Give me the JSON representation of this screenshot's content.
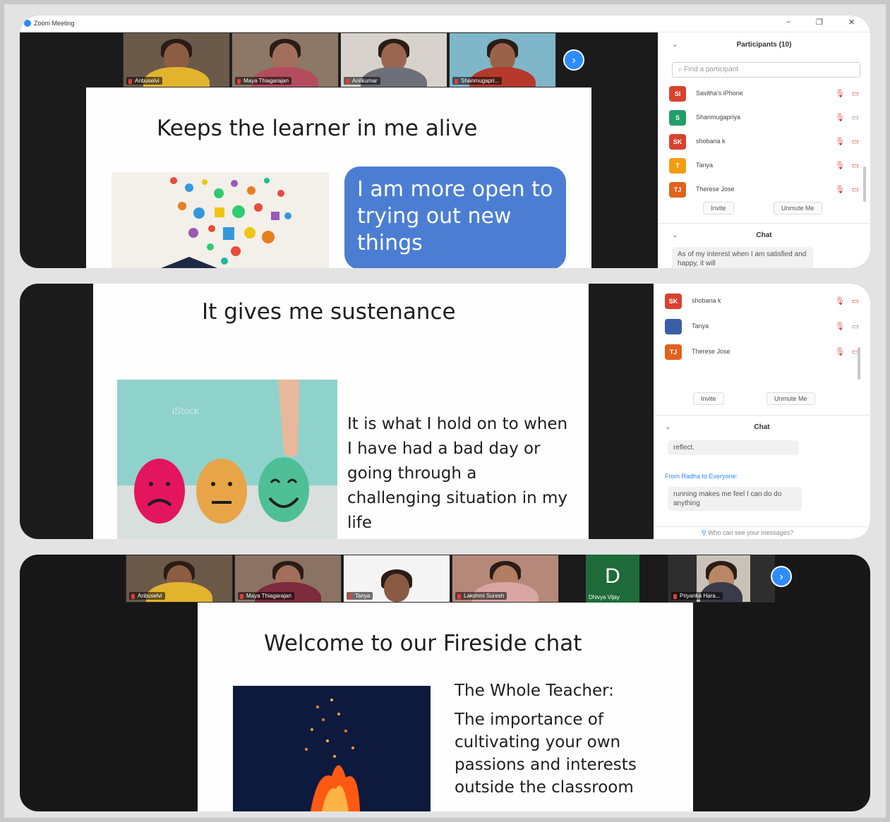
{
  "window": {
    "title": "Zoom Meeting",
    "minimize": "–",
    "restore": "❐",
    "close": "✕"
  },
  "screenshot1": {
    "strip": [
      {
        "name": "Anbuselvi"
      },
      {
        "name": "Maya Thiagarajan"
      },
      {
        "name": "Anilkumar"
      },
      {
        "name": "Shanmugapri..."
      }
    ],
    "slide": {
      "title": "Keeps the learner in me alive",
      "bubble": "I am more open to trying out new things"
    },
    "panel": {
      "participants_header": "Participants (10)",
      "search_placeholder": "Find a participant",
      "participants": [
        {
          "initials": "SI",
          "name": "Savitha's iPhone",
          "color": "#d9412f"
        },
        {
          "initials": "S",
          "name": "Shanmugapriya",
          "color": "#21a067"
        },
        {
          "initials": "SK",
          "name": "shobana k",
          "color": "#d9412f"
        },
        {
          "initials": "T",
          "name": "Tanya",
          "color": "#f39c12"
        },
        {
          "initials": "TJ",
          "name": "Therese Jose",
          "color": "#e0621b"
        }
      ],
      "invite_button": "Invite",
      "unmute_button": "Unmute Me",
      "chat_header": "Chat",
      "chat_messages": [
        "As of my interest when I am satisfied and happy, it will"
      ]
    }
  },
  "screenshot2": {
    "slide": {
      "title": "It gives me sustenance",
      "body": "It is what I hold on to when I have had a bad day or going through a challenging situation in my life",
      "watermark": "iStock"
    },
    "panel": {
      "participants": [
        {
          "initials": "SK",
          "name": "shobana k",
          "color": "#d9412f"
        },
        {
          "initials": "",
          "name": "Tanya",
          "color": "#3b5ea8"
        },
        {
          "initials": "TJ",
          "name": "Therese Jose",
          "color": "#e0621b"
        }
      ],
      "invite_button": "Invite",
      "unmute_button": "Unmute Me",
      "chat_header": "Chat",
      "chat_messages": [
        {
          "text": "reflect."
        },
        {
          "from": "From Radha to Everyone:",
          "text": "running makes me feel I can do do anything"
        }
      ],
      "chat_input_placeholder": "Who can see your messages?"
    }
  },
  "screenshot3": {
    "strip": [
      {
        "name": "Anbuselvi"
      },
      {
        "name": "Maya Thiagarajan"
      },
      {
        "name": "Tanya"
      },
      {
        "name": "Lakshmi Suresh"
      },
      {
        "name": "Dhivya Vijay",
        "letter": "D"
      },
      {
        "name": "Priyanka Hara..."
      }
    ],
    "slide": {
      "title": "Welcome to our Fireside chat",
      "heading": "The  Whole Teacher:",
      "body": "The importance of cultivating your own passions and interests outside the classroom"
    }
  }
}
